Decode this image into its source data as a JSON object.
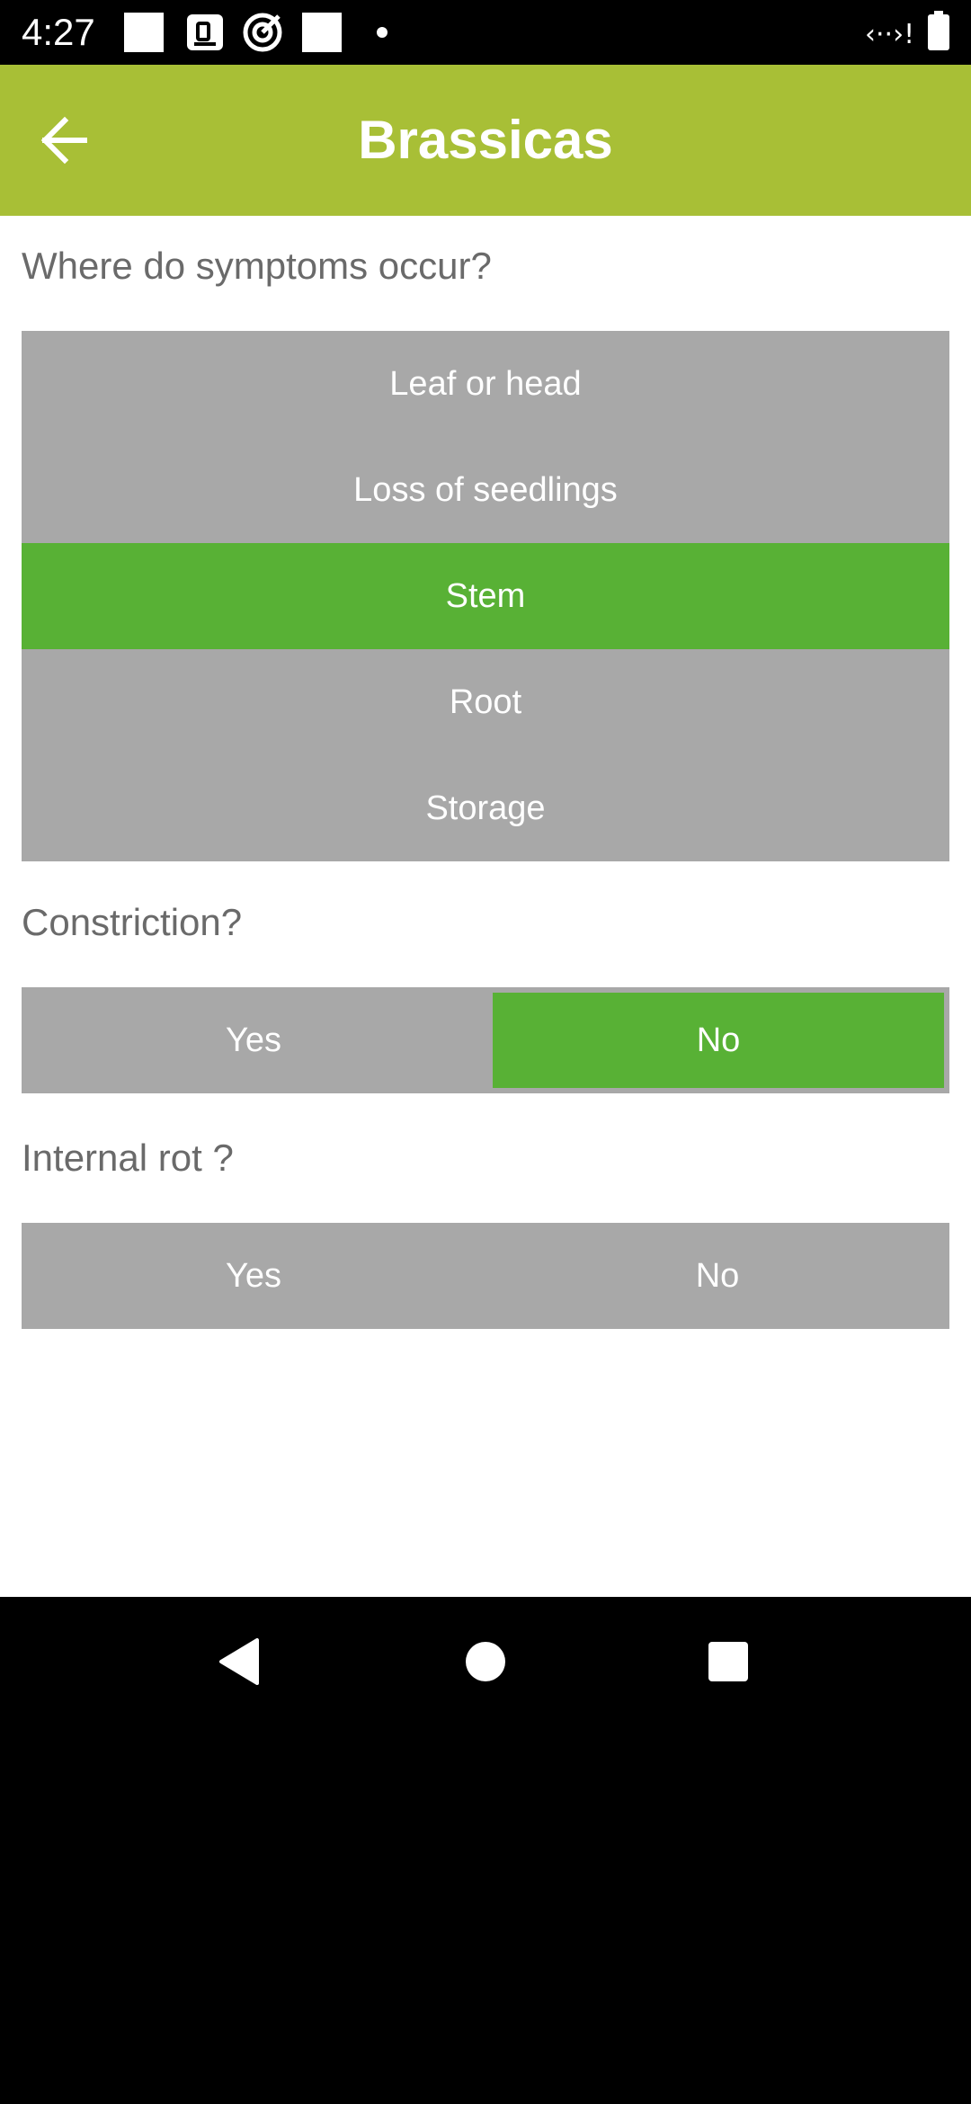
{
  "status_bar": {
    "time": "4:27",
    "icons": [
      "notification-square-icon",
      "notification-d-icon",
      "notification-target-icon",
      "notification-square-icon",
      "more-dot-icon",
      "data-saver-icon",
      "battery-icon"
    ]
  },
  "app_bar": {
    "title": "Brassicas",
    "back_icon": "arrow-back-icon"
  },
  "questions": {
    "symptoms": {
      "label": "Where do symptoms occur?",
      "options": [
        "Leaf or head",
        "Loss of seedlings",
        "Stem",
        "Root",
        "Storage"
      ],
      "selected": "Stem"
    },
    "constriction": {
      "label": "Constriction?",
      "yes": "Yes",
      "no": "No",
      "selected": "No"
    },
    "internal_rot": {
      "label": "Internal rot ?",
      "yes": "Yes",
      "no": "No",
      "selected": ""
    }
  },
  "colors": {
    "app_bar": "#a8bf36",
    "selected": "#58b135",
    "unselected": "#a8a8a8",
    "question_text": "#6a6a6a"
  },
  "nav_bar": {
    "icons": [
      "back-triangle-icon",
      "home-circle-icon",
      "recents-square-icon"
    ]
  }
}
